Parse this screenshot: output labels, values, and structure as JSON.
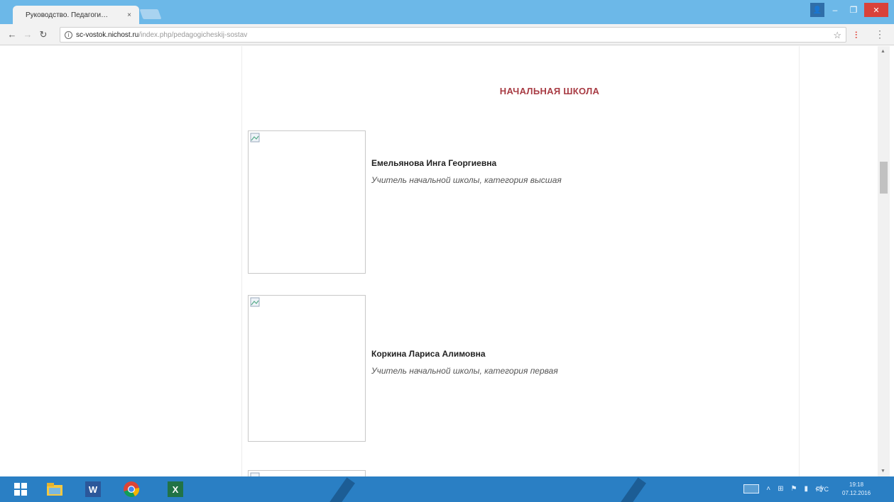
{
  "browser": {
    "tab_title": "Руководство. Педагоги…",
    "tab_close": "×",
    "url_host": "sc-vostok.nichost.ru",
    "url_path": "/index.php/pedagogicheskij-sostav",
    "win_user": "👤",
    "win_min": "–",
    "win_max": "❐",
    "win_close": "✕"
  },
  "content": {
    "section_title": "НАЧАЛЬНАЯ ШКОЛА",
    "teachers": [
      {
        "name": "Емельянова Инга Георгиевна",
        "role": "Учитель начальной школы, категория высшая"
      },
      {
        "name": "Коркина Лариса Алимовна",
        "role": "Учитель начальной школы, категория первая"
      }
    ]
  },
  "taskbar": {
    "lang": "РУС",
    "time": "19:18",
    "date": "07.12.2016"
  },
  "colors": {
    "titlebar": "#6cb8e8",
    "section_title": "#a83c44",
    "taskbar": "#2a7fc4"
  }
}
